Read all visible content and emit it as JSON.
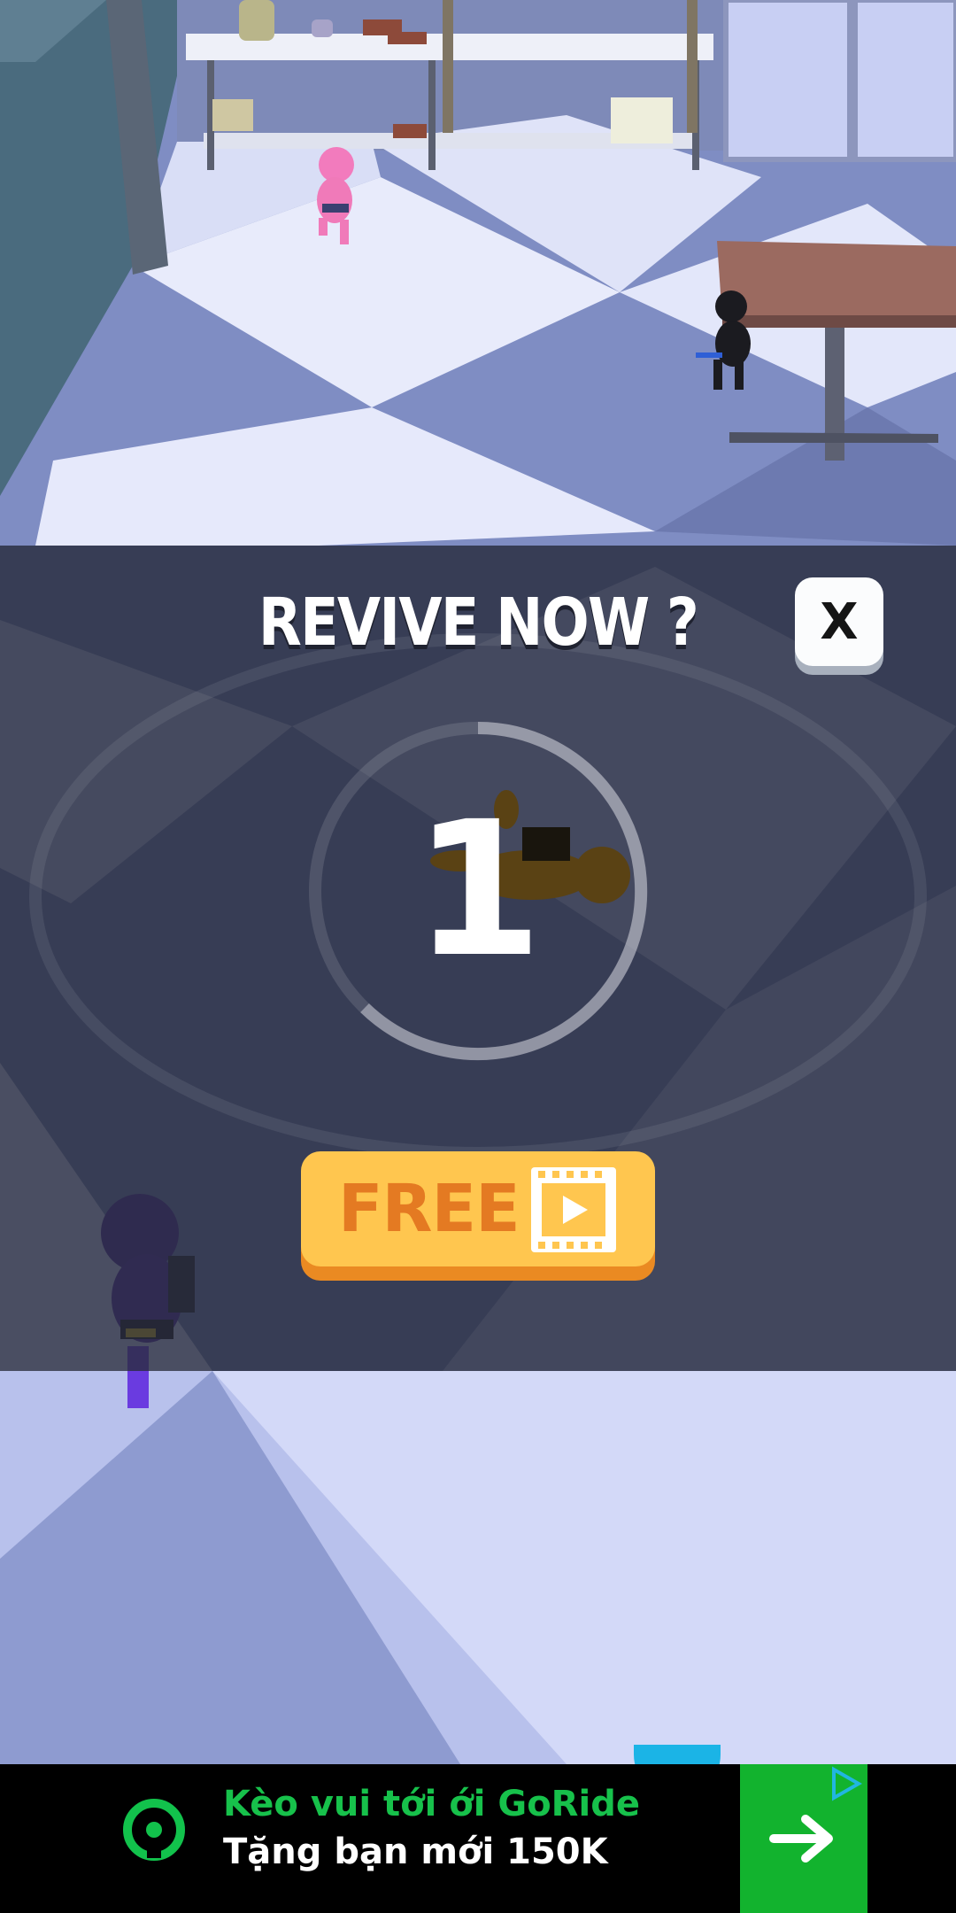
{
  "dialog": {
    "title": "REVIVE NOW ?",
    "close_label": "X",
    "countdown": "1",
    "free_button_label": "FREE",
    "free_button_icon": "video-play-icon"
  },
  "ad": {
    "line1": "Kèo vui tới ới GoRide",
    "line2": "Tặng bạn mới 150K",
    "cta_icon": "arrow-right-icon",
    "brand_icon": "gojek-logo-icon",
    "adchoices_icon": "adchoices-icon"
  },
  "colors": {
    "overlay": "#282c3a",
    "button_face": "#ffc64f",
    "button_shadow": "#ea8a22",
    "button_text": "#e47a22",
    "ad_green": "#12b32e"
  }
}
